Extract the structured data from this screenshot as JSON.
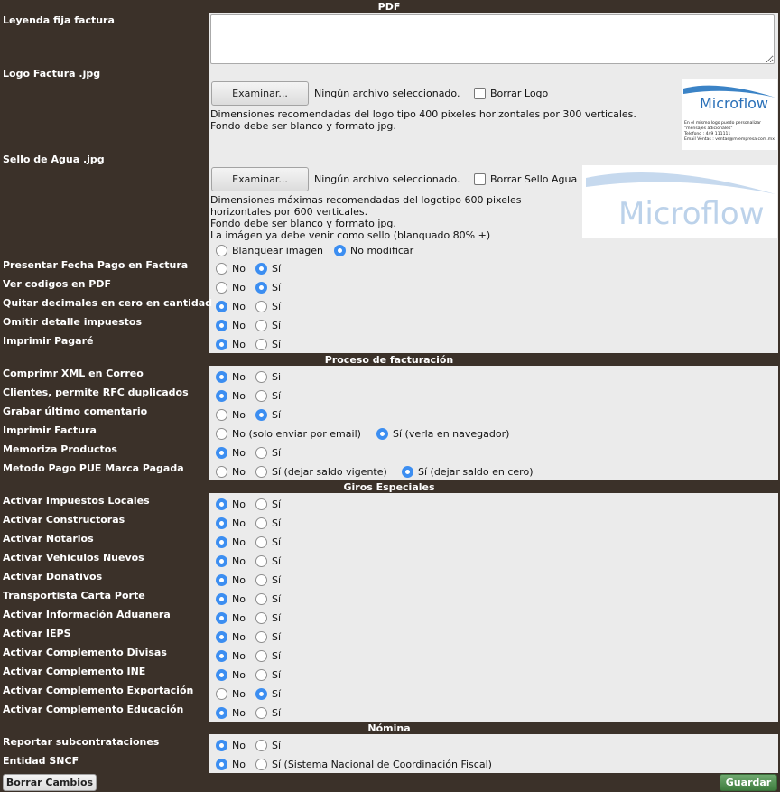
{
  "sections": {
    "pdf": "PDF",
    "proceso": "Proceso de facturación",
    "giros": "Giros Especiales",
    "nomina": "Nómina"
  },
  "pdf": {
    "leyenda_label": "Leyenda fija factura",
    "leyenda_value": "",
    "logo_label": "Logo Factura .jpg",
    "browse_label": "Examinar...",
    "no_file": "Ningún archivo seleccionado.",
    "borrar_logo": "Borrar Logo",
    "logo_hint_1": "Dimensiones recomendadas del logo tipo 400 pixeles horizontales por 300 verticales.",
    "logo_hint_2": "Fondo debe ser blanco y formato jpg.",
    "logo_preview": {
      "brand": "Microflow",
      "line1": "En el mismo logo puedo personalizar",
      "line2": "\"mensajes adicionales\"",
      "line3": "Telefono : 449 111111",
      "line4": "Email Ventas : ventas@miempresa.com.mx"
    },
    "sello_label": "Sello de Agua .jpg",
    "borrar_sello": "Borrar Sello Agua",
    "sello_hint_1": "Dimensiones máximas recomendadas del logotipo 600 pixeles",
    "sello_hint_2": "horizontales por 600 verticales.",
    "sello_hint_3": "Fondo debe ser blanco y formato jpg.",
    "sello_hint_4": "La imágen ya debe venir como sello (blanquado 80% +)",
    "sello_preview_brand": "Microflow",
    "blanquear": "Blanquear imagen",
    "no_modificar": "No modificar"
  },
  "options": {
    "no": "No",
    "si": "Sí",
    "si_plain": "Si"
  },
  "pdf_rows": [
    {
      "label": "Presentar Fecha Pago en Factura",
      "selected": "si"
    },
    {
      "label": "Ver codigos en PDF",
      "selected": "si"
    },
    {
      "label": "Quitar decimales en cero en cantidad",
      "selected": "no"
    },
    {
      "label": "Omitir detalle impuestos",
      "selected": "no"
    },
    {
      "label": "Imprimir Pagaré",
      "selected": "no"
    }
  ],
  "proceso_rows": [
    {
      "label": "Comprimr XML en Correo",
      "selected": "no"
    },
    {
      "label": "Clientes, permite RFC duplicados",
      "selected": "no"
    },
    {
      "label": "Grabar último comentario",
      "selected": "si"
    },
    {
      "label": "Imprimir Factura",
      "selected": "si"
    },
    {
      "label": "Memoriza Productos",
      "selected": "no"
    },
    {
      "label": "Metodo Pago PUE Marca Pagada",
      "selected": "si"
    }
  ],
  "proceso_special": {
    "imprimir_no": "No (solo enviar por email)",
    "imprimir_si": "Sí (verla en navegador)",
    "pue_no": "No",
    "pue_vigente": "Sí (dejar saldo vigente)",
    "pue_cero": "Sí (dejar saldo en cero)"
  },
  "giros_rows": [
    {
      "label": "Activar Impuestos Locales",
      "selected": "no"
    },
    {
      "label": "Activar Constructoras",
      "selected": "no"
    },
    {
      "label": "Activar Notarios",
      "selected": "no"
    },
    {
      "label": "Activar Vehiculos Nuevos",
      "selected": "no"
    },
    {
      "label": "Activar Donativos",
      "selected": "no"
    },
    {
      "label": "Transportista Carta Porte",
      "selected": "no"
    },
    {
      "label": "Activar Información Aduanera",
      "selected": "no"
    },
    {
      "label": "Activar IEPS",
      "selected": "no"
    },
    {
      "label": "Activar Complemento Divisas",
      "selected": "no"
    },
    {
      "label": "Activar Complemento INE",
      "selected": "no"
    },
    {
      "label": "Activar Complemento Exportación",
      "selected": "si"
    },
    {
      "label": "Activar Complemento Educación",
      "selected": "no"
    }
  ],
  "nomina_rows": [
    {
      "label": "Reportar subcontrataciones",
      "selected": "no"
    },
    {
      "label": "Entidad SNCF",
      "selected": "no"
    }
  ],
  "entidad_si": "Sí (Sistema Nacional de Coordinación Fiscal)",
  "footer": {
    "borrar": "Borrar Cambios",
    "guardar": "Guardar"
  }
}
